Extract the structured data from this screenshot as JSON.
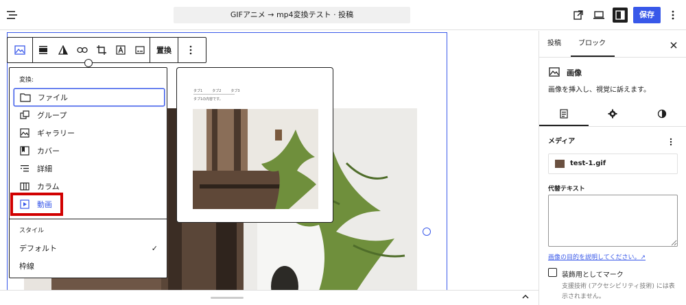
{
  "topbar": {
    "document_title": "GIFアニメ → mp4変換テスト · 投稿",
    "save_label": "保存"
  },
  "block_toolbar": {
    "replace_label": "置換"
  },
  "transform_menu": {
    "heading": "変換:",
    "items": [
      {
        "label": "ファイル",
        "icon": "file-icon"
      },
      {
        "label": "グループ",
        "icon": "group-icon"
      },
      {
        "label": "ギャラリー",
        "icon": "gallery-icon"
      },
      {
        "label": "カバー",
        "icon": "cover-icon"
      },
      {
        "label": "詳細",
        "icon": "details-icon"
      },
      {
        "label": "カラム",
        "icon": "columns-icon"
      },
      {
        "label": "動画",
        "icon": "video-icon"
      }
    ],
    "styles_heading": "スタイル",
    "styles": [
      {
        "label": "デフォルト",
        "selected": true
      },
      {
        "label": "枠線",
        "selected": false
      }
    ]
  },
  "preview": {
    "tabs": [
      "タブ1",
      "タブ2",
      "タブ3"
    ],
    "content": "タブ1の内容です。"
  },
  "sidebar": {
    "tabs": [
      "投稿",
      "ブロック"
    ],
    "active_tab": "ブロック",
    "block_name": "画像",
    "block_description": "画像を挿入し、視覚に訴えます。",
    "media_heading": "メディア",
    "media_file": "test-1.gif",
    "alt_label": "代替テキスト",
    "alt_value": "",
    "alt_help_link": "画像の目的を説明してください。↗",
    "decorative_label": "装飾用としてマーク",
    "decorative_help": "支援技術 (アクセシビリティ技術) には表示されません。"
  },
  "colors": {
    "accent": "#3858e9",
    "highlight_box": "#d10000"
  }
}
